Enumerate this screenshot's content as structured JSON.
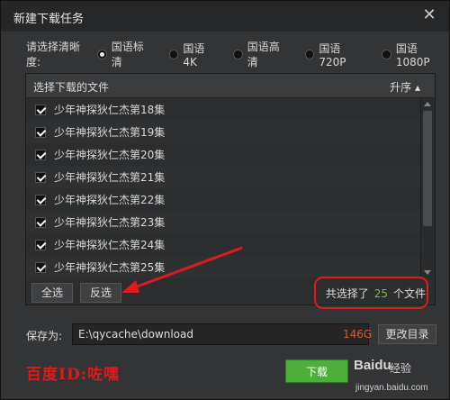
{
  "dialog": {
    "title": "新建下载任务",
    "close_glyph": "✕"
  },
  "quality": {
    "label": "请选择清晰度:",
    "options": [
      {
        "label": "国语标清",
        "selected": true
      },
      {
        "label": "国语4K",
        "selected": false
      },
      {
        "label": "国语高清",
        "selected": false
      },
      {
        "label": "国语720P",
        "selected": false
      },
      {
        "label": "国语1080P",
        "selected": false
      }
    ]
  },
  "filelist": {
    "header_title": "选择下载的文件",
    "sort_label": "升序 ▴",
    "items": [
      "少年神探狄仁杰第18集",
      "少年神探狄仁杰第19集",
      "少年神探狄仁杰第20集",
      "少年神探狄仁杰第21集",
      "少年神探狄仁杰第22集",
      "少年神探狄仁杰第23集",
      "少年神探狄仁杰第24集",
      "少年神探狄仁杰第25集"
    ],
    "select_all_label": "全选",
    "invert_label": "反选",
    "count_prefix": "共选择了",
    "count_value": "25",
    "count_suffix": "个文件"
  },
  "save": {
    "label": "保存为:",
    "path": "E:\\qycache\\download",
    "free_space": "146G",
    "change_dir_label": "更改目录"
  },
  "download_label": "下载",
  "watermark": "百度ID:咗嘿",
  "baidu": {
    "logo": "Baidu",
    "sub": "经验",
    "url": "jingyan.baidu.com"
  },
  "colors": {
    "accent_green": "#4caf3a",
    "count_green": "#7ec321",
    "annotation_red": "#e01b1b",
    "free_space": "#e05a2a"
  }
}
